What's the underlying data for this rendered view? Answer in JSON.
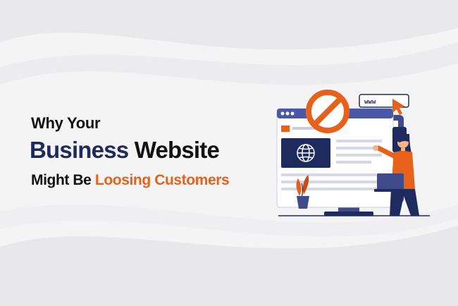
{
  "headline": {
    "line1": "Why Your",
    "line2_part1": "Business",
    "line2_part2": "Website",
    "line3_part1": "Might Be",
    "line3_part2": "Loosing Customers"
  },
  "illustration": {
    "url_box": "www"
  },
  "colors": {
    "navy": "#1e2a5a",
    "orange": "#e8611a",
    "text": "#121212",
    "background": "#f4f4f5"
  }
}
